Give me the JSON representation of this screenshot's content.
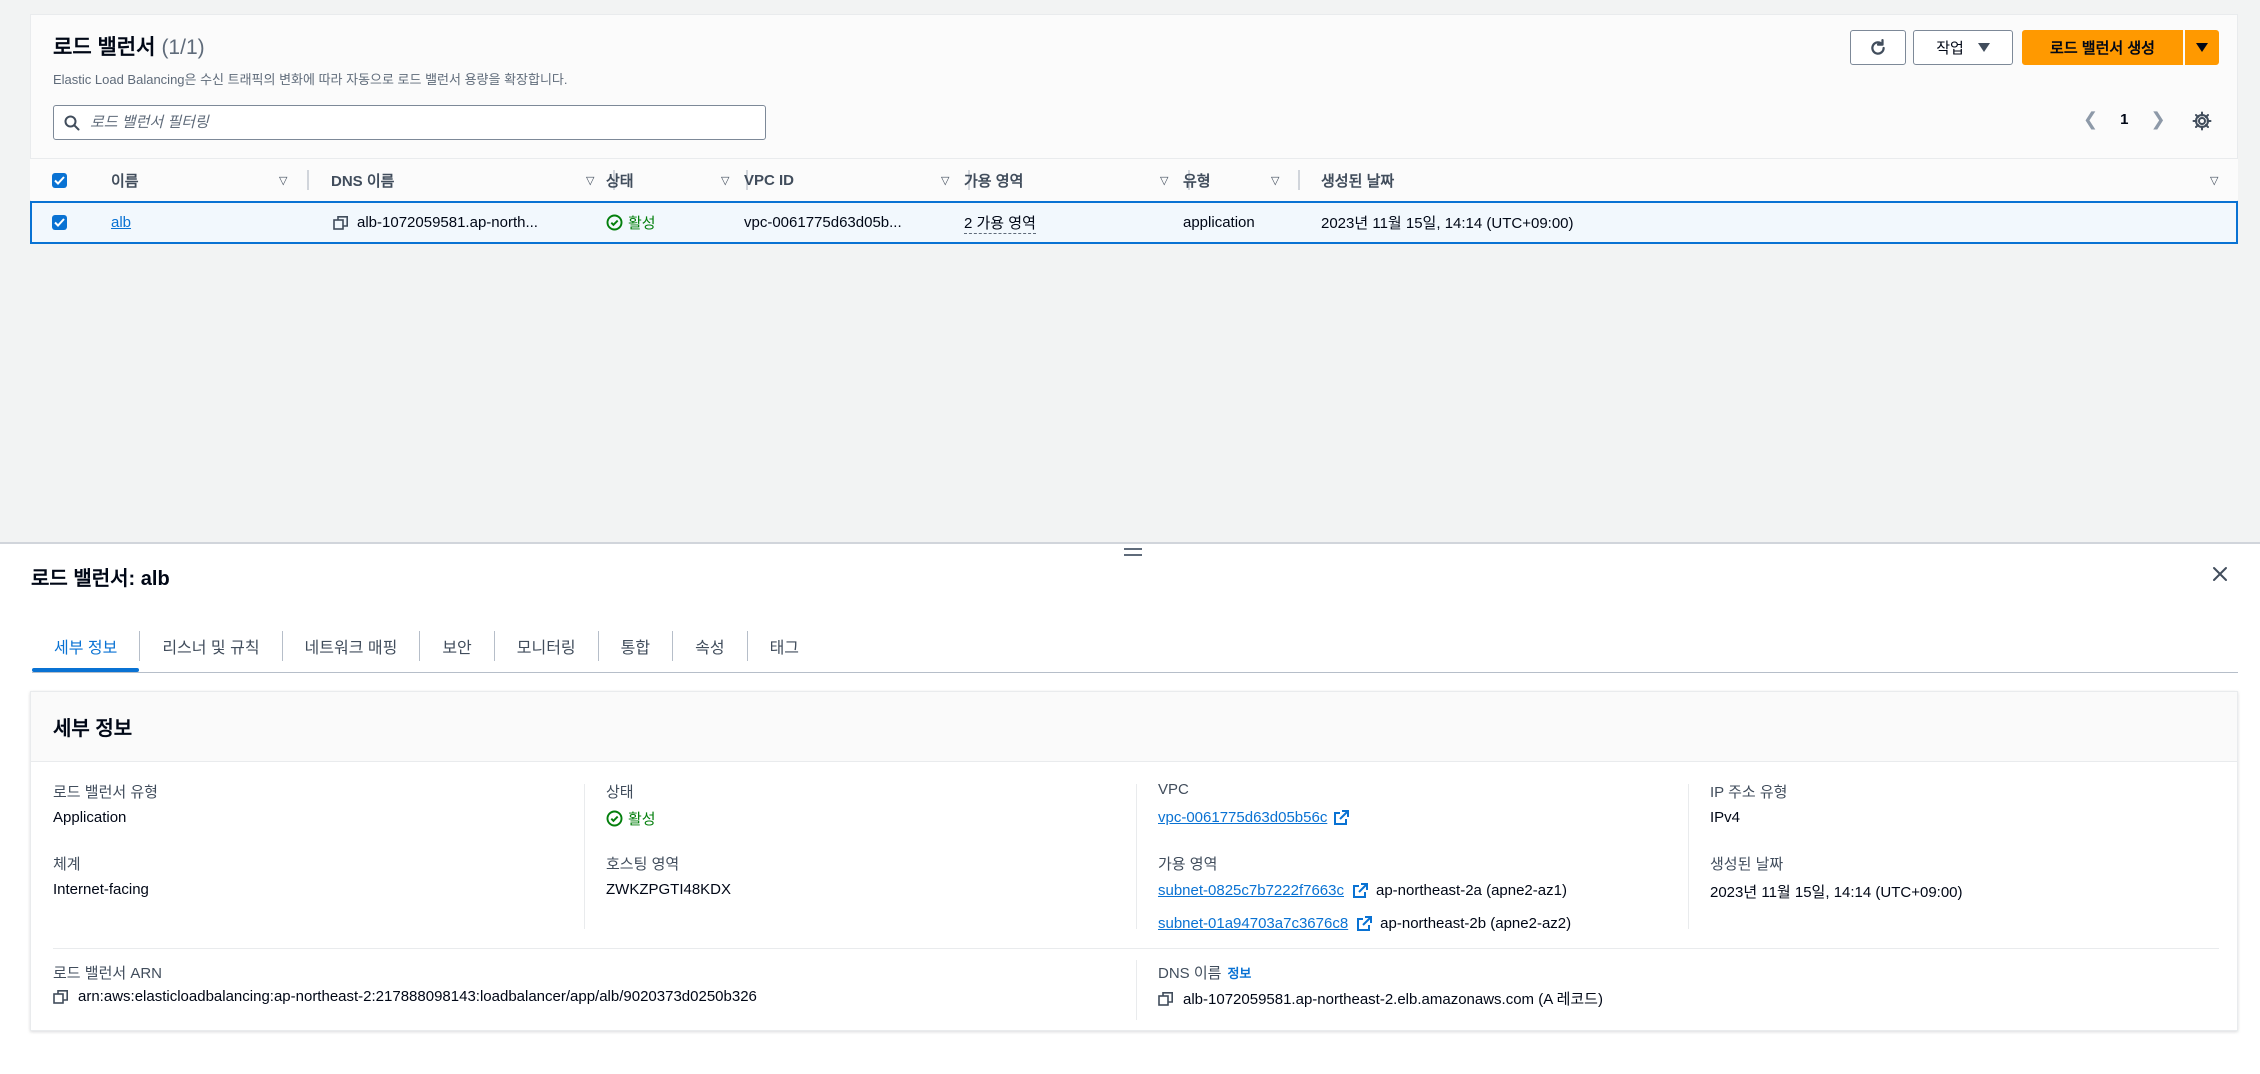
{
  "list": {
    "title": "로드 밸런서",
    "count": "(1/1)",
    "description": "Elastic Load Balancing은 수신 트래픽의 변화에 따라 자동으로 로드 밸런서 용량을 확장합니다.",
    "actions_label": "작업",
    "create_label": "로드 밸런서 생성",
    "filter_placeholder": "로드 밸런서 필터링",
    "page": "1",
    "columns": {
      "name": "이름",
      "dns": "DNS 이름",
      "state": "상태",
      "vpc": "VPC ID",
      "az": "가용 영역",
      "type": "유형",
      "created": "생성된 날짜"
    },
    "row": {
      "name": "alb",
      "dns": "alb-1072059581.ap-north...",
      "state": "활성",
      "vpc": "vpc-0061775d63d05b...",
      "az": "2 가용 영역",
      "type": "application",
      "created": "2023년 11월 15일, 14:14 (UTC+09:00)"
    }
  },
  "detail": {
    "title": "로드 밸런서: alb",
    "tabs": [
      "세부 정보",
      "리스너 및 규칙",
      "네트워크 매핑",
      "보안",
      "모니터링",
      "통합",
      "속성",
      "태그"
    ],
    "section_title": "세부 정보",
    "lb_type_label": "로드 밸런서 유형",
    "lb_type": "Application",
    "state_label": "상태",
    "state": "활성",
    "vpc_label": "VPC",
    "vpc": "vpc-0061775d63d05b56c",
    "ip_type_label": "IP 주소 유형",
    "ip_type": "IPv4",
    "scheme_label": "체계",
    "scheme": "Internet-facing",
    "hosted_zone_label": "호스팅 영역",
    "hosted_zone": "ZWKZPGTI48KDX",
    "az_label": "가용 영역",
    "subnets": [
      {
        "id": "subnet-0825c7b7222f7663c",
        "zone": "ap-northeast-2a (apne2-az1)"
      },
      {
        "id": "subnet-01a94703a7c3676c8",
        "zone": "ap-northeast-2b (apne2-az2)"
      }
    ],
    "created_label": "생성된 날짜",
    "created": "2023년 11월 15일, 14:14 (UTC+09:00)",
    "arn_label": "로드 밸런서 ARN",
    "arn": "arn:aws:elasticloadbalancing:ap-northeast-2:217888098143:loadbalancer/app/alb/9020373d0250b326",
    "dns_label": "DNS 이름",
    "dns_info": "정보",
    "dns": "alb-1072059581.ap-northeast-2.elb.amazonaws.com (A 레코드)"
  },
  "colors": {
    "accent": "#0972d3",
    "primary_button": "#ff9900",
    "success": "#037f0c"
  }
}
